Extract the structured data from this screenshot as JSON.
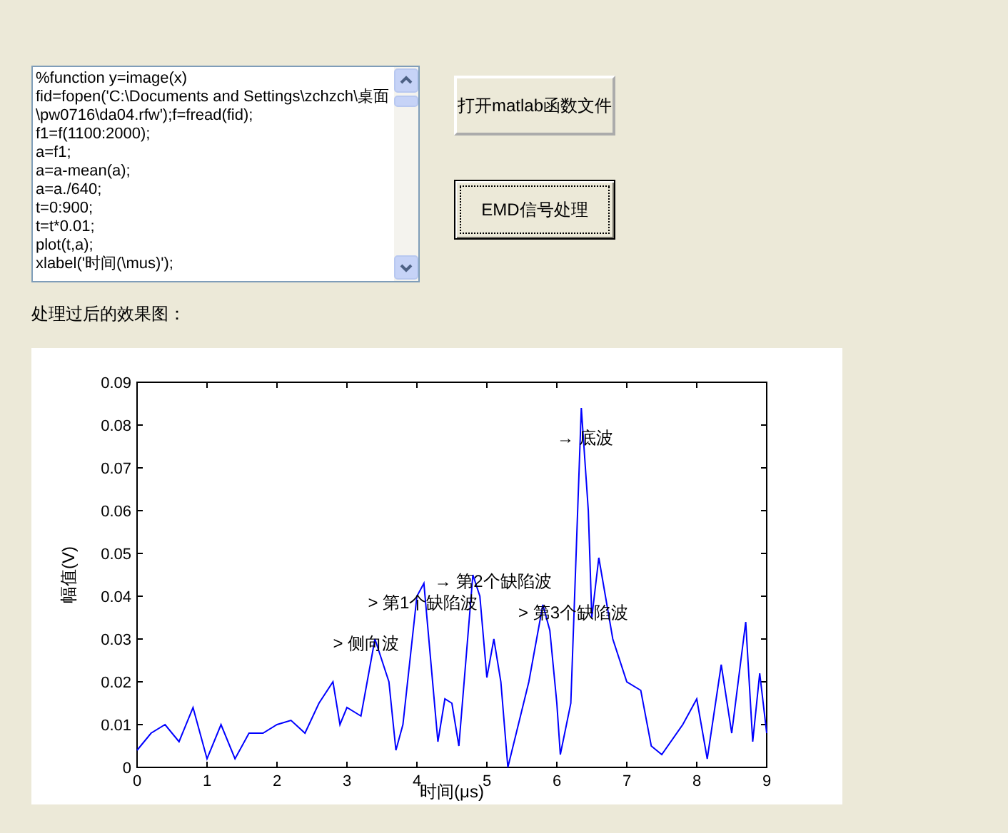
{
  "code_editor": {
    "lines": [
      "%function y=image(x)",
      "fid=fopen('C:\\Documents and Settings\\zchzch\\桌面",
      "\\pw0716\\da04.rfw');f=fread(fid);",
      "f1=f(1100:2000);",
      "a=f1;",
      "a=a-mean(a);",
      "a=a./640;",
      "t=0:900;",
      "t=t*0.01;",
      "plot(t,a);",
      "xlabel('时间(\\mus)');"
    ]
  },
  "buttons": [
    {
      "label": "打开matlab函数文件",
      "focused": false
    },
    {
      "label": "EMD信号处理",
      "focused": true
    }
  ],
  "result_label": "处理过后的效果图：",
  "plot": {
    "chart_data": {
      "type": "line",
      "xlabel": "时间(μs)",
      "ylabel": "幅值(V)",
      "xlim": [
        0,
        9
      ],
      "ylim": [
        0,
        0.09
      ],
      "xticks": [
        {
          "value": 0,
          "label": "0"
        },
        {
          "value": 1,
          "label": "1"
        },
        {
          "value": 2,
          "label": "2"
        },
        {
          "value": 3,
          "label": "3"
        },
        {
          "value": 4,
          "label": "4"
        },
        {
          "value": 5,
          "label": "5"
        },
        {
          "value": 6,
          "label": "6"
        },
        {
          "value": 7,
          "label": "7"
        },
        {
          "value": 8,
          "label": "8"
        },
        {
          "value": 9,
          "label": "9"
        }
      ],
      "yticks": [
        {
          "value": 0,
          "label": "0"
        },
        {
          "value": 0.01,
          "label": "0.01"
        },
        {
          "value": 0.02,
          "label": "0.02"
        },
        {
          "value": 0.03,
          "label": "0.03"
        },
        {
          "value": 0.04,
          "label": "0.04"
        },
        {
          "value": 0.05,
          "label": "0.05"
        },
        {
          "value": 0.06,
          "label": "0.06"
        },
        {
          "value": 0.07,
          "label": "0.07"
        },
        {
          "value": 0.08,
          "label": "0.08"
        },
        {
          "value": 0.09,
          "label": "0.09"
        }
      ],
      "x": [
        0,
        0.2,
        0.4,
        0.6,
        0.8,
        1.0,
        1.2,
        1.4,
        1.6,
        1.8,
        2.0,
        2.2,
        2.4,
        2.6,
        2.8,
        2.9,
        3.0,
        3.2,
        3.4,
        3.6,
        3.7,
        3.8,
        4.0,
        4.1,
        4.3,
        4.4,
        4.5,
        4.6,
        4.8,
        4.9,
        5.0,
        5.1,
        5.2,
        5.3,
        5.6,
        5.8,
        5.9,
        6.0,
        6.05,
        6.2,
        6.35,
        6.45,
        6.5,
        6.6,
        6.8,
        7.0,
        7.2,
        7.35,
        7.5,
        7.8,
        8.0,
        8.15,
        8.35,
        8.5,
        8.7,
        8.8,
        8.9,
        9.0
      ],
      "series": [
        {
          "color": "#0000ff",
          "values": [
            0.004,
            0.008,
            0.01,
            0.006,
            0.014,
            0.002,
            0.01,
            0.002,
            0.008,
            0.008,
            0.01,
            0.011,
            0.008,
            0.015,
            0.02,
            0.01,
            0.014,
            0.012,
            0.03,
            0.02,
            0.004,
            0.01,
            0.04,
            0.043,
            0.006,
            0.016,
            0.015,
            0.005,
            0.045,
            0.04,
            0.021,
            0.03,
            0.02,
            0.0,
            0.02,
            0.038,
            0.032,
            0.015,
            0.003,
            0.015,
            0.084,
            0.06,
            0.035,
            0.049,
            0.03,
            0.02,
            0.018,
            0.005,
            0.003,
            0.01,
            0.016,
            0.002,
            0.024,
            0.008,
            0.034,
            0.006,
            0.022,
            0.008
          ]
        }
      ],
      "annotations": [
        "→ 底波",
        "> 侧向波",
        "> 第1个缺陷波",
        "→ 第2个缺陷波",
        "> 第3个缺陷波"
      ]
    }
  }
}
